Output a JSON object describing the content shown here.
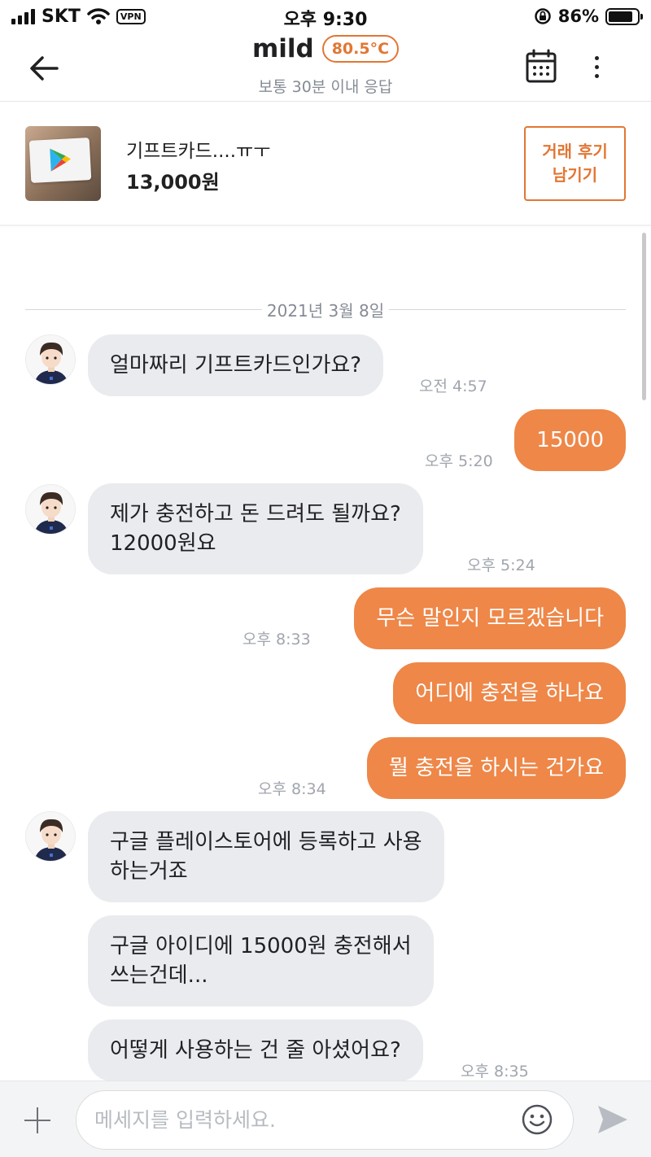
{
  "status_bar": {
    "carrier": "SKT",
    "vpn": "VPN",
    "time": "오후 9:30",
    "battery": "86%",
    "battery_level": 0.86
  },
  "header": {
    "nickname": "mild",
    "temperature": "80.5°C",
    "response_time": "보통 30분 이내 응답"
  },
  "product": {
    "title": "기프트카드....ㅠㅜ",
    "price": "13,000원",
    "review_button": [
      "거래 후기",
      "남기기"
    ]
  },
  "chat": {
    "date": "2021년 3월 8일",
    "messages": [
      {
        "side": "in",
        "text": "얼마짜리 기프트카드인가요?",
        "time": "오전 4:57"
      },
      {
        "side": "out",
        "text": "15000",
        "time": "오후 5:20"
      },
      {
        "side": "in",
        "text": "제가 충전하고 돈 드려도 될까요?\n12000원요",
        "time": "오후 5:24"
      },
      {
        "side": "out",
        "text": "무슨 말인지 모르겠습니다",
        "time": "오후 8:33"
      },
      {
        "side": "out",
        "text": "어디에 충전을 하나요",
        "time": ""
      },
      {
        "side": "out",
        "text": "뭘 충전을 하시는 건가요",
        "time": "오후 8:34"
      },
      {
        "side": "in",
        "text": "구글 플레이스토어에 등록하고 사용\n하는거죠",
        "time": ""
      },
      {
        "side": "in",
        "text": "구글 아이디에 15000원 충전해서\n쓰는건데...",
        "time": ""
      },
      {
        "side": "in",
        "text": "어떻게 사용하는 건 줄 아셨어요?",
        "time": "오후 8:35"
      }
    ]
  },
  "input": {
    "placeholder": "메세지를 입력하세요."
  },
  "icons": {
    "back": "back-arrow-icon",
    "calendar": "calendar-icon",
    "more": "more-vertical-icon",
    "plus": "plus-icon",
    "emoji": "emoji-icon",
    "send": "send-icon"
  },
  "colors": {
    "accent": "#ee8748",
    "temp": "#e27634",
    "incoming_bubble": "#eaebee",
    "meta_text": "#a0a5ad"
  }
}
